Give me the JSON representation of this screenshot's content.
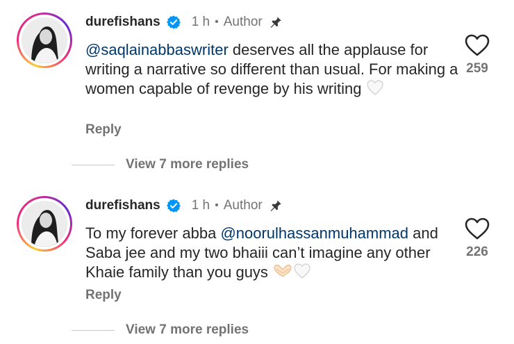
{
  "comments": [
    {
      "username": "durefishans",
      "time": "1 h",
      "separator": "•",
      "role": "Author",
      "mention": "@saqlainabbaswriter",
      "text_after_mention": " deserves all the applause for writing a narrative so different than usual. For making a women capable of revenge by his writing",
      "emojis": [
        "white-heart"
      ],
      "reply_label": "Reply",
      "view_more_label": "View 7 more replies",
      "like_count": "259"
    },
    {
      "username": "durefishans",
      "time": "1 h",
      "separator": "•",
      "role": "Author",
      "text_before_mention": "To my forever abba ",
      "mention": "@noorulhassanmuhammad",
      "text_after_mention": " and Saba jee and my two bhaiii can’t imagine any other Khaie family than you guys ",
      "emojis": [
        "heart-hands",
        "white-heart"
      ],
      "reply_label": "Reply",
      "view_more_label": "View 7 more replies",
      "like_count": "226"
    }
  ],
  "colors": {
    "mention": "#00376b",
    "verified": "#0095f6",
    "secondary_text": "#737373",
    "primary_text": "#262626"
  }
}
